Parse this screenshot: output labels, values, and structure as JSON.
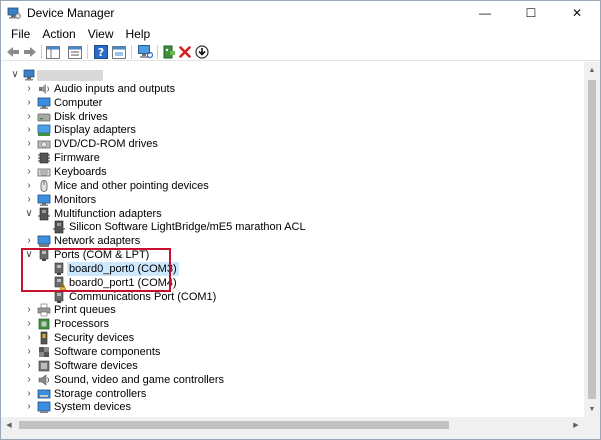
{
  "window": {
    "title": "Device Manager",
    "controls": {
      "minimize": "—",
      "maximize": "☐",
      "close": "✕"
    }
  },
  "menu": [
    "File",
    "Action",
    "View",
    "Help"
  ],
  "toolbar": [
    {
      "name": "back-icon"
    },
    {
      "name": "forward-icon"
    },
    {
      "name": "properties-pane-icon"
    },
    {
      "name": "device-list-icon"
    },
    {
      "name": "help-icon"
    },
    {
      "name": "properties-icon"
    },
    {
      "name": "scan-hardware-icon"
    },
    {
      "name": "update-driver-icon"
    },
    {
      "name": "uninstall-icon"
    },
    {
      "name": "download-icon"
    }
  ],
  "tree": {
    "root_expander": "∨",
    "categories": [
      {
        "label": "Audio inputs and outputs",
        "icon": "audio-icon",
        "expanded": false
      },
      {
        "label": "Computer",
        "icon": "computer-icon",
        "expanded": false
      },
      {
        "label": "Disk drives",
        "icon": "disk-icon",
        "expanded": false
      },
      {
        "label": "Display adapters",
        "icon": "display-icon",
        "expanded": false
      },
      {
        "label": "DVD/CD-ROM drives",
        "icon": "dvd-icon",
        "expanded": false
      },
      {
        "label": "Firmware",
        "icon": "firmware-icon",
        "expanded": false
      },
      {
        "label": "Keyboards",
        "icon": "keyboard-icon",
        "expanded": false
      },
      {
        "label": "Mice and other pointing devices",
        "icon": "mouse-icon",
        "expanded": false
      },
      {
        "label": "Monitors",
        "icon": "monitor-icon",
        "expanded": false
      },
      {
        "label": "Multifunction adapters",
        "icon": "multifunction-icon",
        "expanded": true,
        "children": [
          {
            "label": "Silicon Software LightBridge/mE5 marathon ACL",
            "icon": "multifunction-icon"
          }
        ]
      },
      {
        "label": "Network adapters",
        "icon": "network-icon",
        "expanded": false
      },
      {
        "label": "Ports (COM & LPT)",
        "icon": "port-icon",
        "expanded": true,
        "children": [
          {
            "label": "board0_port0 (COM3)",
            "icon": "port-icon",
            "selected": true
          },
          {
            "label": "board0_port1 (COM4)",
            "icon": "port-warning-icon"
          },
          {
            "label": "Communications Port (COM1)",
            "icon": "port-icon"
          }
        ]
      },
      {
        "label": "Print queues",
        "icon": "printer-icon",
        "expanded": false
      },
      {
        "label": "Processors",
        "icon": "processor-icon",
        "expanded": false
      },
      {
        "label": "Security devices",
        "icon": "security-icon",
        "expanded": false
      },
      {
        "label": "Software components",
        "icon": "software-component-icon",
        "expanded": false
      },
      {
        "label": "Software devices",
        "icon": "software-device-icon",
        "expanded": false
      },
      {
        "label": "Sound, video and game controllers",
        "icon": "sound-icon",
        "expanded": false
      },
      {
        "label": "Storage controllers",
        "icon": "storage-icon",
        "expanded": false
      },
      {
        "label": "System devices",
        "icon": "system-icon",
        "expanded": false
      }
    ]
  },
  "colors": {
    "selection": "#cce8ff",
    "highlight": "#c8102e",
    "folder_blue": "#1e90d6"
  }
}
